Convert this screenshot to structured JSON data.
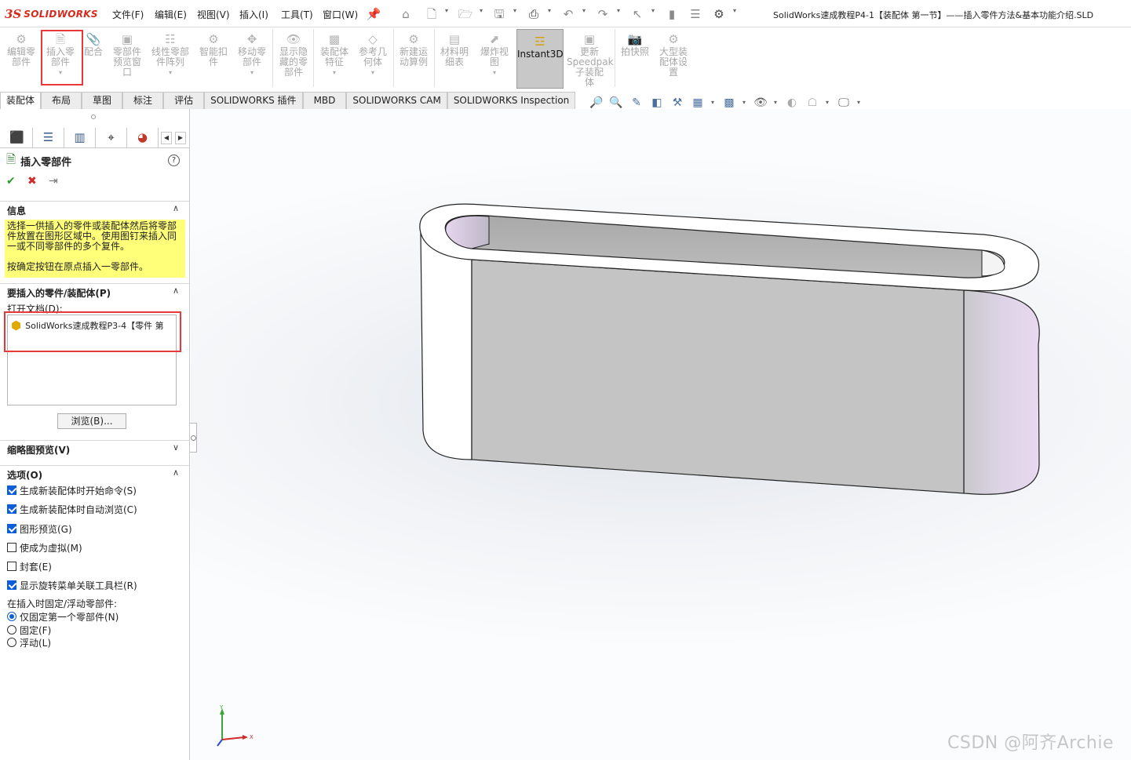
{
  "app": {
    "logo_mark": "3S",
    "logo_text": "SOLIDWORKS"
  },
  "menu": [
    "文件(F)",
    "编辑(E)",
    "视图(V)",
    "插入(I)",
    "工具(T)",
    "窗口(W)"
  ],
  "window_title": "SolidWorks速成教程P4-1【装配体  第一节】——插入零件方法&基本功能介绍.SLD",
  "commands": [
    {
      "name": "edit-component",
      "label1": "编辑零",
      "label2": "部件",
      "label3": ""
    },
    {
      "name": "insert-component",
      "label1": "插入零",
      "label2": "部件",
      "label3": ""
    },
    {
      "name": "mate",
      "label1": "配合",
      "label2": "",
      "label3": ""
    },
    {
      "name": "component-preview",
      "label1": "零部件",
      "label2": "预览窗",
      "label3": "口"
    },
    {
      "name": "linear-pattern",
      "label1": "线性零部",
      "label2": "件阵列",
      "label3": ""
    },
    {
      "name": "smart-fastener",
      "label1": "智能扣",
      "label2": "件",
      "label3": ""
    },
    {
      "name": "move-component",
      "label1": "移动零",
      "label2": "部件",
      "label3": ""
    },
    {
      "name": "show-hidden",
      "label1": "显示隐",
      "label2": "藏的零",
      "label3": "部件"
    },
    {
      "name": "assembly-feature",
      "label1": "装配体",
      "label2": "特征",
      "label3": ""
    },
    {
      "name": "reference-geometry",
      "label1": "参考几",
      "label2": "何体",
      "label3": ""
    },
    {
      "name": "new-motion-study",
      "label1": "新建运",
      "label2": "动算例",
      "label3": ""
    },
    {
      "name": "bill-of-materials",
      "label1": "材料明",
      "label2": "细表",
      "label3": ""
    },
    {
      "name": "exploded-view",
      "label1": "爆炸视",
      "label2": "图",
      "label3": ""
    },
    {
      "name": "instant3d",
      "label1": "Instant3D",
      "label2": "",
      "label3": ""
    },
    {
      "name": "update-speedpak",
      "label1": "更新",
      "label2": "Speedpak",
      "label3": "子装配",
      "label4": "体"
    },
    {
      "name": "snapshot",
      "label1": "拍快照",
      "label2": "",
      "label3": ""
    },
    {
      "name": "large-assembly",
      "label1": "大型装",
      "label2": "配体设",
      "label3": "置"
    }
  ],
  "tabs": [
    "装配体",
    "布局",
    "草图",
    "标注",
    "评估",
    "SOLIDWORKS 插件",
    "MBD",
    "SOLIDWORKS CAM",
    "SOLIDWORKS Inspection"
  ],
  "property_manager": {
    "title": "插入零部件",
    "help": "?",
    "info_header": "信息",
    "info_text_1": "选择一供插入的零件或装配体然后将零部件放置在图形区域中。使用图钉来插入同一或不同零部件的多个复件。",
    "info_text_2": "按确定按钮在原点插入一零部件。",
    "part_header": "要插入的零件/装配体(P)",
    "open_docs_label": "打开文档(D):",
    "open_doc_item": "SolidWorks速成教程P3-4【零件  第",
    "browse_label": "浏览(B)...",
    "thumbnail_header": "缩略图预览(V)",
    "options_header": "选项(O)",
    "options": [
      {
        "label": "生成新装配体时开始命令(S)",
        "checked": true
      },
      {
        "label": "生成新装配体时自动浏览(C)",
        "checked": true
      },
      {
        "label": "图形预览(G)",
        "checked": true
      },
      {
        "label": "使成为虚拟(M)",
        "checked": false
      },
      {
        "label": "封套(E)",
        "checked": false
      },
      {
        "label": "显示旋转菜单关联工具栏(R)",
        "checked": true
      }
    ],
    "fix_float_label": "在插入时固定/浮动零部件:",
    "radios": [
      {
        "label": "仅固定第一个零部件(N)",
        "selected": true
      },
      {
        "label": "固定(F)",
        "selected": false
      },
      {
        "label": "浮动(L)",
        "selected": false
      }
    ]
  },
  "triad": {
    "x": "X",
    "y": "Y"
  },
  "watermark": "CSDN @阿齐Archie",
  "colors": {
    "brand": "#d52b1e",
    "highlight_box": "#e8393a",
    "info_bg": "#ffff7a",
    "check_blue": "#0b5ed7"
  }
}
